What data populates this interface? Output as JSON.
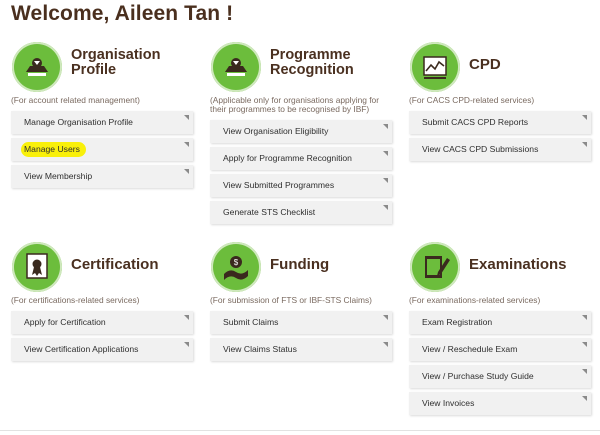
{
  "page": {
    "welcome": "Welcome, Aileen Tan !"
  },
  "sections": [
    {
      "title_line1": "Organisation",
      "title_line2": "Profile",
      "subtitle": "(For account related management)",
      "icon": "org-profile-icon",
      "items": [
        "Manage Organisation Profile",
        "Manage Users",
        "View Membership"
      ]
    },
    {
      "title_line1": "Programme",
      "title_line2": "Recognition",
      "subtitle": "(Applicable only for organisations applying for their programmes to be recognised by IBF)",
      "icon": "programme-recognition-icon",
      "items": [
        "View Organisation Eligibility",
        "Apply for Programme Recognition",
        "View Submitted Programmes",
        "Generate STS Checklist"
      ]
    },
    {
      "title": "CPD",
      "subtitle": "(For CACS CPD-related services)",
      "icon": "cpd-chart-icon",
      "items": [
        "Submit CACS CPD Reports",
        "View CACS CPD Submissions"
      ]
    },
    {
      "title": "Certification",
      "subtitle": "(For certifications-related services)",
      "icon": "certificate-icon",
      "items": [
        "Apply for Certification",
        "View Certification Applications"
      ]
    },
    {
      "title": "Funding",
      "subtitle": "(For submission of FTS or IBF-STS Claims)",
      "icon": "funding-icon",
      "items": [
        "Submit Claims",
        "View Claims Status"
      ]
    },
    {
      "title": "Examinations",
      "subtitle": "(For examinations-related services)",
      "icon": "exam-pencil-icon",
      "items": [
        "Exam Registration",
        "View / Reschedule Exam",
        "View / Purchase Study Guide",
        "View Invoices"
      ]
    }
  ],
  "colors": {
    "icon_green": "#6cbd3c",
    "highlight": "#f9f00a",
    "title": "#4a3020"
  }
}
